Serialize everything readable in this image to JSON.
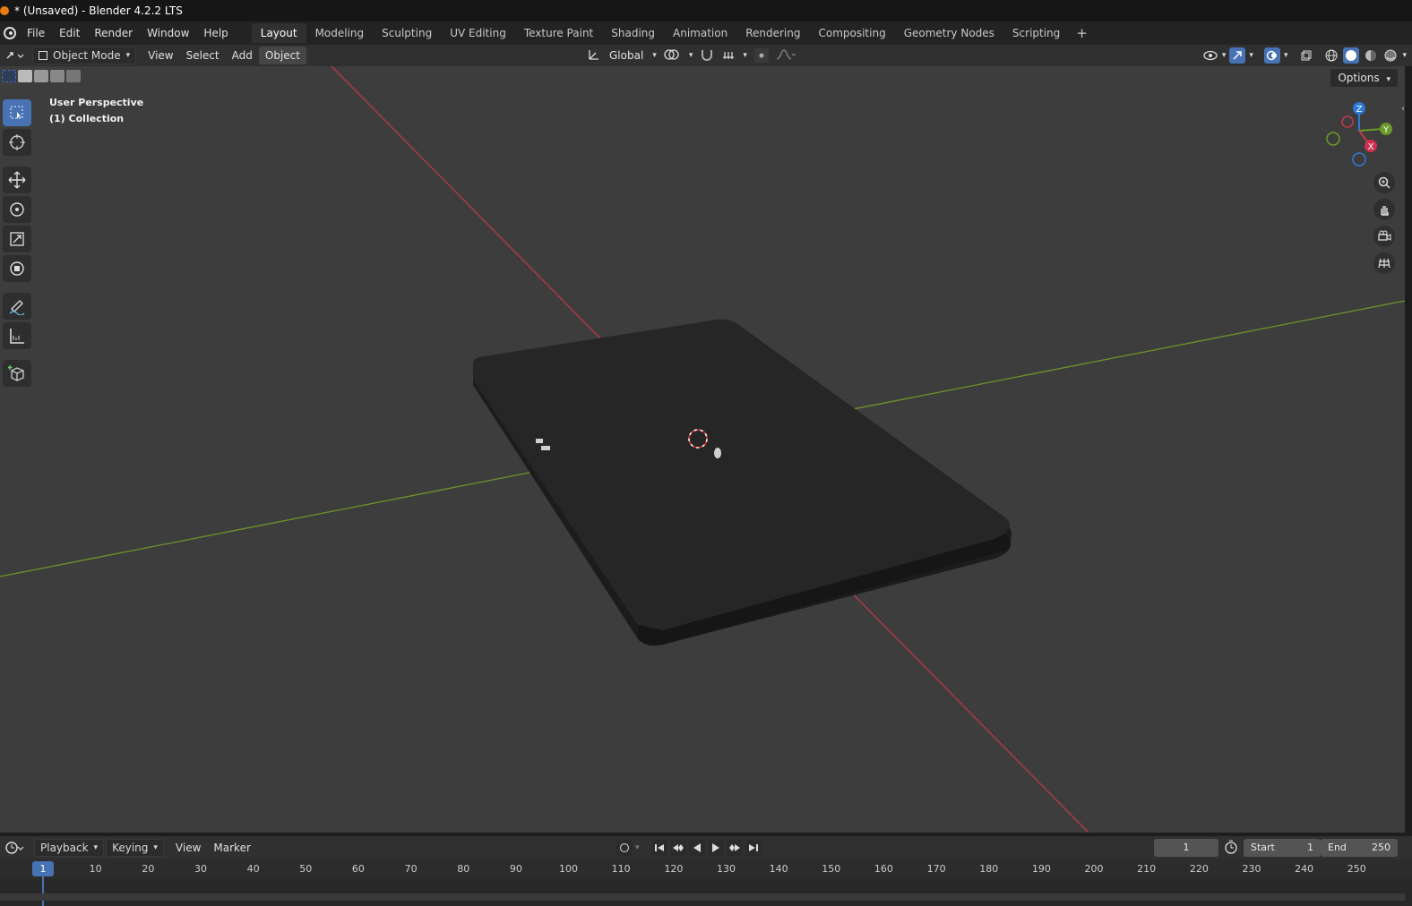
{
  "window": {
    "title": "* (Unsaved) - Blender 4.2.2 LTS"
  },
  "menu": [
    "File",
    "Edit",
    "Render",
    "Window",
    "Help"
  ],
  "workspace_tabs": [
    {
      "label": "Layout",
      "active": true
    },
    {
      "label": "Modeling",
      "active": false
    },
    {
      "label": "Sculpting",
      "active": false
    },
    {
      "label": "UV Editing",
      "active": false
    },
    {
      "label": "Texture Paint",
      "active": false
    },
    {
      "label": "Shading",
      "active": false
    },
    {
      "label": "Animation",
      "active": false
    },
    {
      "label": "Rendering",
      "active": false
    },
    {
      "label": "Compositing",
      "active": false
    },
    {
      "label": "Geometry Nodes",
      "active": false
    },
    {
      "label": "Scripting",
      "active": false
    }
  ],
  "header3d": {
    "mode": "Object Mode",
    "view": "View",
    "select": "Select",
    "add": "Add",
    "object": "Object",
    "transform_orientation": "Global"
  },
  "viewport": {
    "perspective": "User Perspective",
    "collection": "(1) Collection",
    "options": "Options",
    "gizmo": {
      "z": "Z",
      "y": "Y",
      "x": "X"
    }
  },
  "tools": [
    "select-box-icon",
    "cursor-icon",
    "move-icon",
    "rotate-icon",
    "scale-icon",
    "transform-icon",
    "annotate-icon",
    "measure-icon",
    "add-cube-icon"
  ],
  "timeline_header": {
    "playback": "Playback",
    "keying": "Keying",
    "view": "View",
    "marker": "Marker",
    "current_frame": "1",
    "start_label": "Start",
    "start_value": "1",
    "end_label": "End",
    "end_value": "250"
  },
  "timeline": {
    "current": "1",
    "ticks": [
      "10",
      "20",
      "30",
      "40",
      "50",
      "60",
      "70",
      "80",
      "90",
      "100",
      "110",
      "120",
      "130",
      "140",
      "150",
      "160",
      "170",
      "180",
      "190",
      "200",
      "210",
      "220",
      "230",
      "240",
      "250"
    ]
  },
  "colors": {
    "accent": "#4772b3",
    "x_axis": "#c23b4b",
    "y_axis": "#6a9a2a",
    "z_axis": "#2e7ad6",
    "viewport_bg": "#3d3d3d"
  }
}
